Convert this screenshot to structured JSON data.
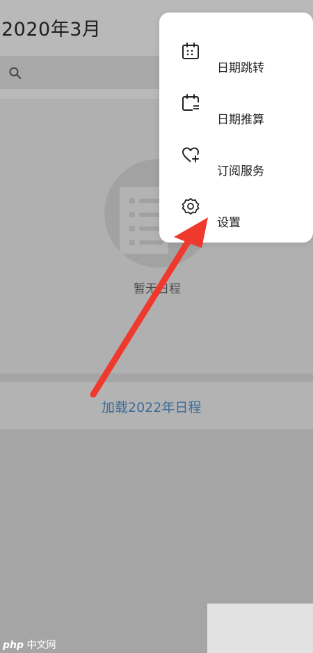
{
  "header": {
    "month_title": "2020年3月",
    "search_icon": "search-icon"
  },
  "empty_state": {
    "text": "暂无日程",
    "icon": "schedule-empty-icon"
  },
  "load_more": {
    "label": "加载2022年日程",
    "color": "#3e6c97"
  },
  "menu": {
    "items": [
      {
        "label": "日期跳转",
        "icon": "calendar-jump-icon"
      },
      {
        "label": "日期推算",
        "icon": "calendar-calc-icon"
      },
      {
        "label": "订阅服务",
        "icon": "heart-plus-icon"
      },
      {
        "label": "设置",
        "icon": "gear-icon"
      }
    ]
  },
  "annotation": {
    "arrow_color": "#f0392e"
  },
  "watermark": {
    "text_php": "php",
    "text_site": "中文网"
  }
}
